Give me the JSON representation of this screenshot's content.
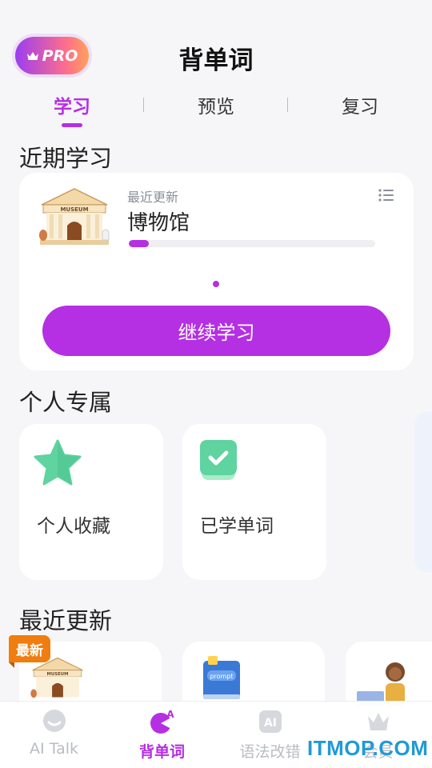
{
  "header": {
    "pro_label": "PRO",
    "title": "背单词"
  },
  "tabs": [
    {
      "label": "学习",
      "active": true
    },
    {
      "label": "预览",
      "active": false
    },
    {
      "label": "复习",
      "active": false
    }
  ],
  "recent": {
    "section_title": "近期学习",
    "subtitle": "最近更新",
    "name": "博物馆",
    "progress_fraction": 0.08,
    "continue_label": "继续学习",
    "illustration_text": "MUSEUM"
  },
  "personal": {
    "section_title": "个人专属",
    "tiles": [
      {
        "label": "个人收藏",
        "icon": "star-icon"
      },
      {
        "label": "已学单词",
        "icon": "check-icon"
      }
    ]
  },
  "latest": {
    "section_title": "最近更新",
    "new_tag": "最新",
    "book_text": "prompt"
  },
  "tabbar": {
    "items": [
      {
        "label": "AI Talk",
        "icon": "chat-bubble-icon",
        "active": false
      },
      {
        "label": "背单词",
        "icon": "vocab-icon",
        "active": true
      },
      {
        "label": "语法改错",
        "icon": "ai-icon",
        "active": false
      },
      {
        "label": "会员",
        "icon": "crown-icon",
        "active": false
      }
    ]
  },
  "watermark": "ITMOP.COM",
  "colors": {
    "accent": "#b52fe3",
    "background": "#f6f6f8",
    "new_tag": "#f07d0f",
    "star": "#5fd3a0",
    "watermark": "#1f9ad6"
  }
}
